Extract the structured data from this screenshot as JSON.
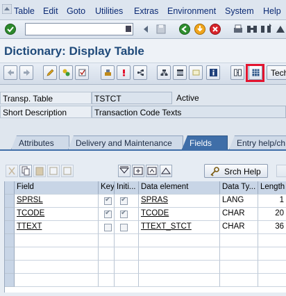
{
  "menu": {
    "items": [
      "Table",
      "Edit",
      "Goto",
      "Utilities",
      "Extras",
      "Environment",
      "System",
      "Help"
    ]
  },
  "toolbar": {
    "command_value": ""
  },
  "title": "Dictionary: Display Table",
  "app_toolbar": {
    "technical_label": "Tech"
  },
  "header": {
    "transp_table_label": "Transp. Table",
    "transp_table_value": "TSTCT",
    "status": "Active",
    "short_desc_label": "Short Description",
    "short_desc_value": "Transaction Code Texts"
  },
  "tabs": [
    {
      "label": "Attributes",
      "active": false
    },
    {
      "label": "Delivery and Maintenance",
      "active": false
    },
    {
      "label": "Fields",
      "active": true
    },
    {
      "label": "Entry help/ch",
      "active": false
    }
  ],
  "table_tools": {
    "search_help_label": "Srch Help"
  },
  "grid": {
    "columns": [
      "Field",
      "Key",
      "Initi...",
      "Data element",
      "Data Ty...",
      "Length"
    ],
    "rows": [
      {
        "field": "SPRSL",
        "key": true,
        "initial": true,
        "data_element": "SPRAS",
        "data_type": "LANG",
        "length": "1"
      },
      {
        "field": "TCODE",
        "key": true,
        "initial": true,
        "data_element": "TCODE",
        "data_type": "CHAR",
        "length": "20"
      },
      {
        "field": "TTEXT",
        "key": false,
        "initial": false,
        "data_element": "TTEXT_STCT",
        "data_type": "CHAR",
        "length": "36"
      }
    ]
  },
  "colors": {
    "title": "#1f4a7a",
    "active_tab": "#3f6ea8",
    "highlight": "#e3132e"
  },
  "icons": [
    "sap-menu-icon",
    "enter-icon",
    "save-icon",
    "back-icon",
    "exit-icon",
    "cancel-icon",
    "print-icon",
    "find-icon",
    "find-next-icon",
    "first-page-icon",
    "previous-page-icon",
    "next-page-icon",
    "last-page-icon",
    "other-object-icon",
    "display-change-icon",
    "check-icon",
    "activate-icon",
    "where-used-icon",
    "object-list-icon",
    "hierarchy-icon",
    "technical-settings-icon",
    "indexes-icon",
    "append-structure-icon",
    "info-icon",
    "dictionary-view-icon",
    "contents-icon"
  ]
}
